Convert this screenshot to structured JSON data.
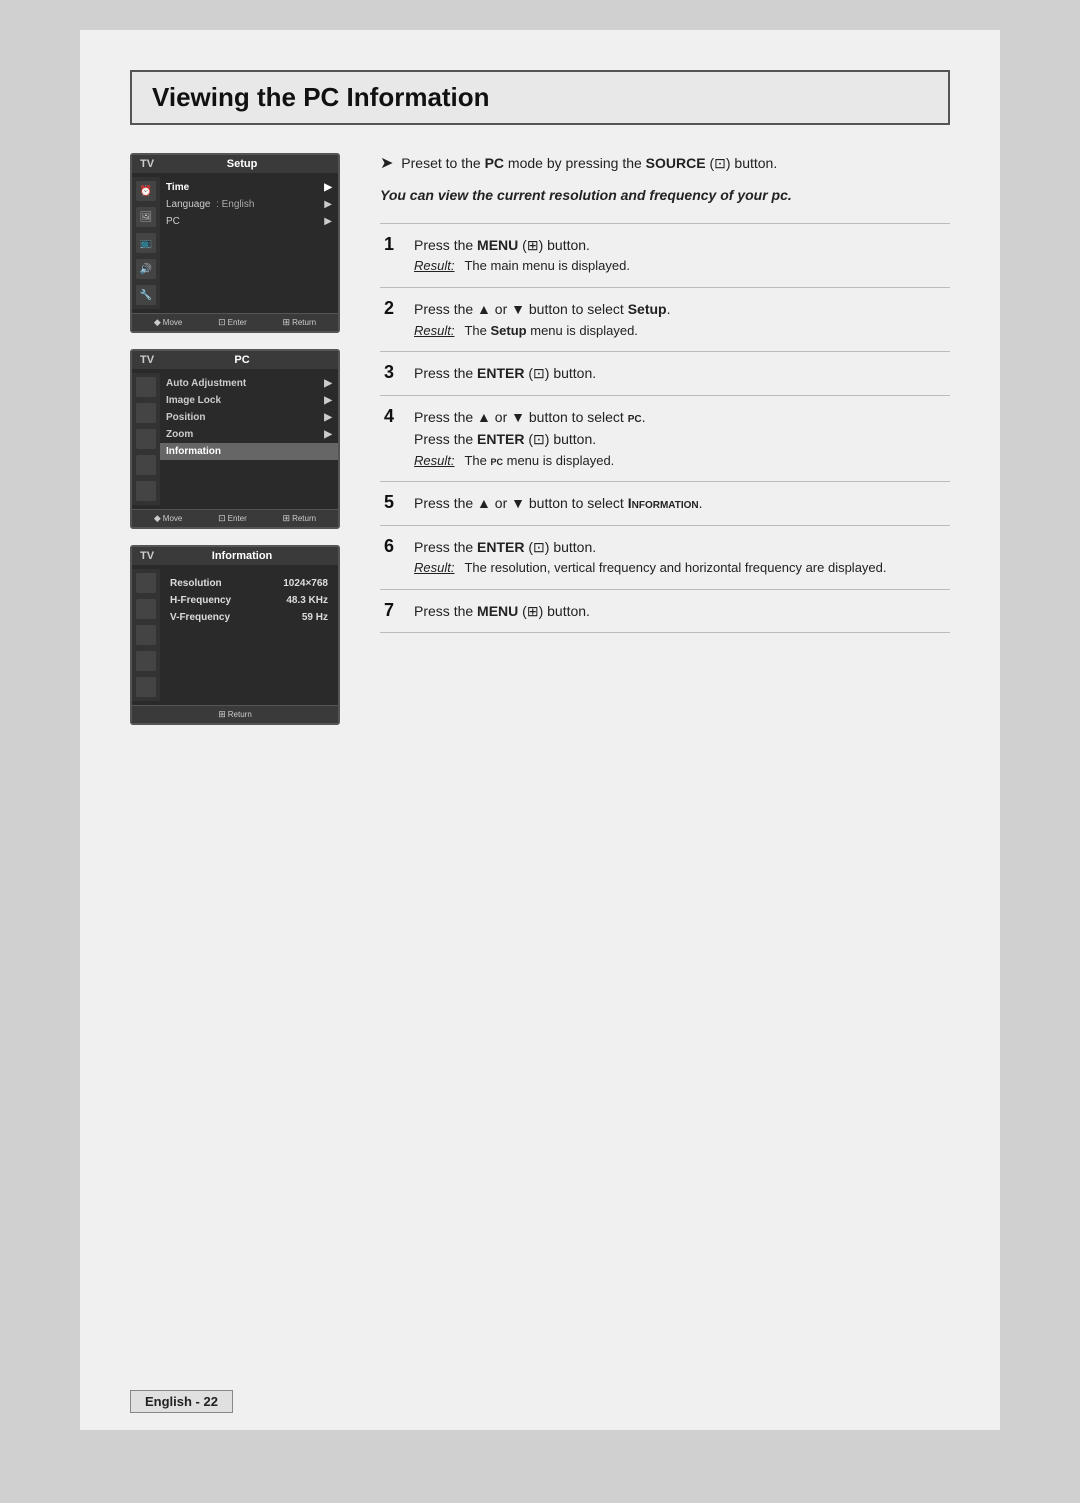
{
  "page": {
    "title": "Viewing the PC Information",
    "preset_note": "Preset to the PC mode by pressing the SOURCE (⊡) button.",
    "italic_note": "You can view the current resolution and frequency of your pc.",
    "footer": "English - 22"
  },
  "screens": {
    "screen1": {
      "label": "TV",
      "title": "Setup",
      "rows": [
        {
          "icon": "⏰",
          "label": "Time",
          "value": "",
          "arrow": "▶",
          "highlighted": false
        },
        {
          "icon": "",
          "label": "Language",
          "value": ": English",
          "arrow": "▶",
          "highlighted": false
        },
        {
          "icon": "",
          "label": "PC",
          "value": "",
          "arrow": "▶",
          "highlighted": false
        }
      ],
      "footer": [
        "◆ Move",
        "⊡ Enter",
        "⊞ Return"
      ]
    },
    "screen2": {
      "label": "TV",
      "title": "PC",
      "rows": [
        {
          "label": "Auto Adjustment",
          "arrow": "▶",
          "highlighted": false
        },
        {
          "label": "Image Lock",
          "arrow": "▶",
          "highlighted": false
        },
        {
          "label": "Position",
          "arrow": "▶",
          "highlighted": false
        },
        {
          "label": "Zoom",
          "arrow": "▶",
          "highlighted": false
        },
        {
          "label": "Information",
          "arrow": "",
          "highlighted": true
        }
      ],
      "footer": [
        "◆ Move",
        "⊡ Enter",
        "⊞ Return"
      ]
    },
    "screen3": {
      "label": "TV",
      "title": "Information",
      "rows": [
        {
          "label": "Resolution",
          "value": "1024×768"
        },
        {
          "label": "H-Frequency",
          "value": "48.3  KHz"
        },
        {
          "label": "V-Frequency",
          "value": "59  Hz"
        }
      ],
      "footer": [
        "⊞ Return"
      ]
    }
  },
  "steps": [
    {
      "number": "1",
      "instruction": "Press the MENU (⊞) button.",
      "result_label": "Result:",
      "result_text": "The main menu is displayed."
    },
    {
      "number": "2",
      "instruction": "Press the ▲ or ▼ button to select Setup.",
      "result_label": "Result:",
      "result_text": "The Setup menu is displayed."
    },
    {
      "number": "3",
      "instruction": "Press the ENTER (⊡) button.",
      "result_label": "",
      "result_text": ""
    },
    {
      "number": "4",
      "instruction": "Press the ▲ or ▼ button to select PC.",
      "instruction2": "Press the ENTER (⊡) button.",
      "result_label": "Result:",
      "result_text": "The PC menu is displayed."
    },
    {
      "number": "5",
      "instruction": "Press the ▲ or ▼ button to select Information.",
      "result_label": "",
      "result_text": ""
    },
    {
      "number": "6",
      "instruction": "Press the ENTER (⊡) button.",
      "result_label": "Result:",
      "result_text": "The resolution, vertical frequency and horizontal frequency are displayed."
    },
    {
      "number": "7",
      "instruction": "Press the MENU (⊞) button.",
      "result_label": "",
      "result_text": ""
    }
  ]
}
